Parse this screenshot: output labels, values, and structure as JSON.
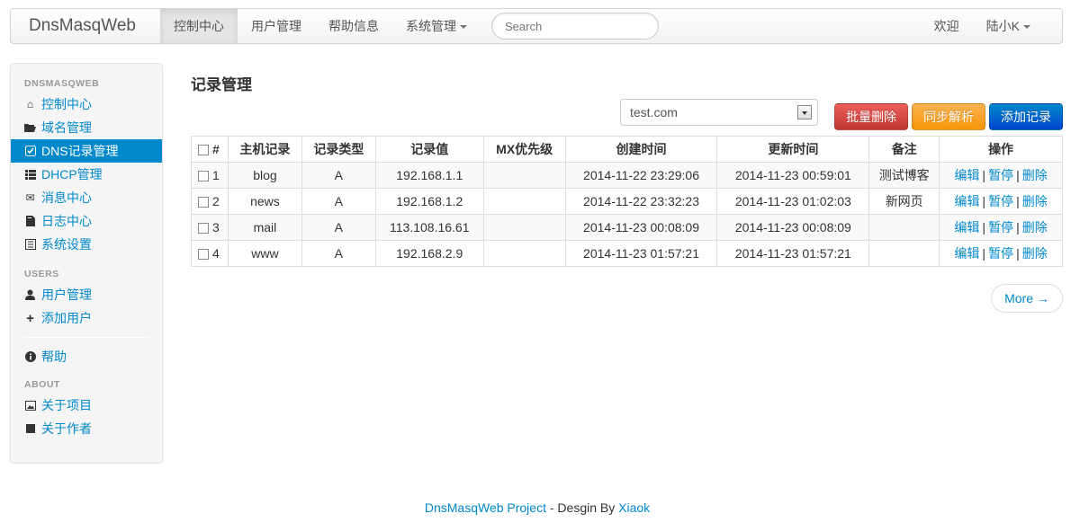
{
  "navbar": {
    "brand": "DnsMasqWeb",
    "items": [
      {
        "label": "控制中心",
        "active": true
      },
      {
        "label": "用户管理"
      },
      {
        "label": "帮助信息"
      },
      {
        "label": "系统管理"
      }
    ],
    "search_placeholder": "Search",
    "welcome": "欢迎",
    "user": "陆小K"
  },
  "sidebar": {
    "sections": [
      {
        "header": "DNSMASQWEB",
        "items": [
          {
            "label": "控制中心",
            "icon": "home-icon"
          },
          {
            "label": "域名管理",
            "icon": "folder-open-icon"
          },
          {
            "label": "DNS记录管理",
            "icon": "check-icon",
            "active": true
          },
          {
            "label": "DHCP管理",
            "icon": "list-icon"
          },
          {
            "label": "消息中心",
            "icon": "envelope-icon"
          },
          {
            "label": "日志中心",
            "icon": "file-icon"
          },
          {
            "label": "系统设置",
            "icon": "list-alt-icon"
          }
        ]
      },
      {
        "header": "USERS",
        "items": [
          {
            "label": "用户管理",
            "icon": "user-icon"
          },
          {
            "label": "添加用户",
            "icon": "plus-icon"
          }
        ]
      },
      {
        "header": "",
        "items": [
          {
            "label": "帮助",
            "icon": "info-icon"
          }
        ]
      },
      {
        "header": "ABOUT",
        "items": [
          {
            "label": "关于项目",
            "icon": "picture-icon"
          },
          {
            "label": "关于作者",
            "icon": "stop-icon"
          }
        ]
      }
    ]
  },
  "main": {
    "title": "记录管理",
    "domain_select": "test.com",
    "buttons": {
      "batch_delete": "批量删除",
      "sync": "同步解析",
      "add": "添加记录"
    },
    "table": {
      "headers": [
        "#",
        "主机记录",
        "记录类型",
        "记录值",
        "MX优先级",
        "创建时间",
        "更新时间",
        "备注",
        "操作"
      ],
      "rows": [
        {
          "num": "1",
          "host": "blog",
          "type": "A",
          "value": "192.168.1.1",
          "mx": "",
          "created": "2014-11-22 23:29:06",
          "updated": "2014-11-23 00:59:01",
          "note": "测试博客"
        },
        {
          "num": "2",
          "host": "news",
          "type": "A",
          "value": "192.168.1.2",
          "mx": "",
          "created": "2014-11-22 23:32:23",
          "updated": "2014-11-23 01:02:03",
          "note": "新网页"
        },
        {
          "num": "3",
          "host": "mail",
          "type": "A",
          "value": "113.108.16.61",
          "mx": "",
          "created": "2014-11-23 00:08:09",
          "updated": "2014-11-23 00:08:09",
          "note": ""
        },
        {
          "num": "4",
          "host": "www",
          "type": "A",
          "value": "192.168.2.9",
          "mx": "",
          "created": "2014-11-23 01:57:21",
          "updated": "2014-11-23 01:57:21",
          "note": ""
        }
      ],
      "actions": {
        "edit": "编辑",
        "pause": "暂停",
        "delete": "删除",
        "separator": "|"
      }
    },
    "more": "More →"
  },
  "footer": {
    "project": "DnsMasqWeb Project",
    "middle": " - Desgin By ",
    "author": "Xiaok"
  }
}
